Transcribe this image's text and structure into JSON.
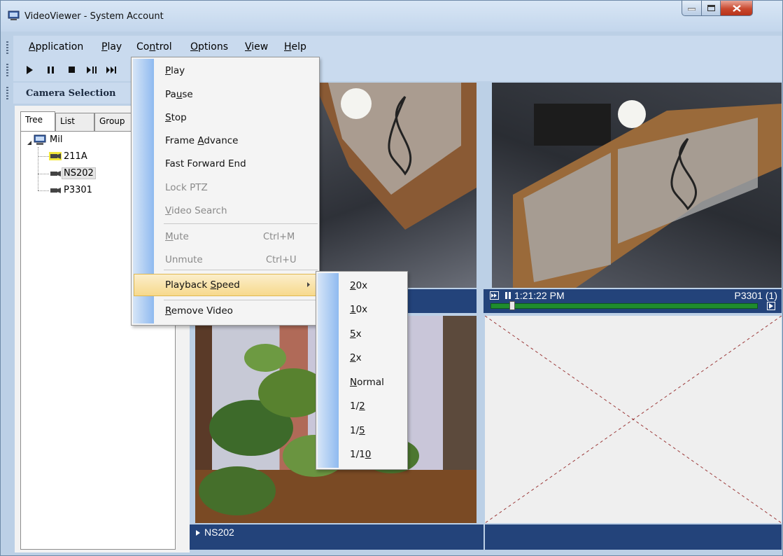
{
  "window": {
    "title": "VideoViewer - System Account"
  },
  "menubar": {
    "items": [
      {
        "label": "Application",
        "key": "A"
      },
      {
        "label": "Play",
        "key": "P"
      },
      {
        "label": "Control",
        "key": "n"
      },
      {
        "label": "Options",
        "key": "O"
      },
      {
        "label": "View",
        "key": "V"
      },
      {
        "label": "Help",
        "key": "H"
      }
    ]
  },
  "camera_selection": {
    "title": "Camera Selection",
    "tabs": [
      "Tree",
      "List",
      "Group"
    ],
    "tree": {
      "root": "Mil",
      "cameras": [
        "211A",
        "NS202",
        "P3301"
      ]
    }
  },
  "control_menu": {
    "items": [
      {
        "label": "Play",
        "enabled": true
      },
      {
        "label": "Pause",
        "enabled": true
      },
      {
        "label": "Stop",
        "enabled": true
      },
      {
        "label": "Frame Advance",
        "enabled": true
      },
      {
        "label": "Fast Forward End",
        "enabled": true
      },
      {
        "label": "Lock PTZ",
        "enabled": false
      },
      {
        "label": "Video Search",
        "enabled": false
      },
      {
        "label": "Mute",
        "enabled": false,
        "shortcut": "Ctrl+M"
      },
      {
        "label": "Unmute",
        "enabled": false,
        "shortcut": "Ctrl+U"
      },
      {
        "label": "Playback Speed",
        "enabled": true,
        "highlighted": true
      },
      {
        "label": "Remove Video",
        "enabled": true
      }
    ]
  },
  "speed_menu": {
    "items": [
      "20x",
      "10x",
      "5x",
      "2x",
      "Normal",
      "1/2",
      "1/5",
      "1/10"
    ]
  },
  "panes": {
    "top_right": {
      "time": "1:21:22 PM",
      "camera": "P3301 (1)"
    },
    "bottom_left": {
      "camera": "NS202"
    }
  },
  "colors": {
    "titlebar": "#c3d6ec",
    "status_bar": "#23437a",
    "highlight": "#f7d98c",
    "progress": "#1f8c2e"
  }
}
